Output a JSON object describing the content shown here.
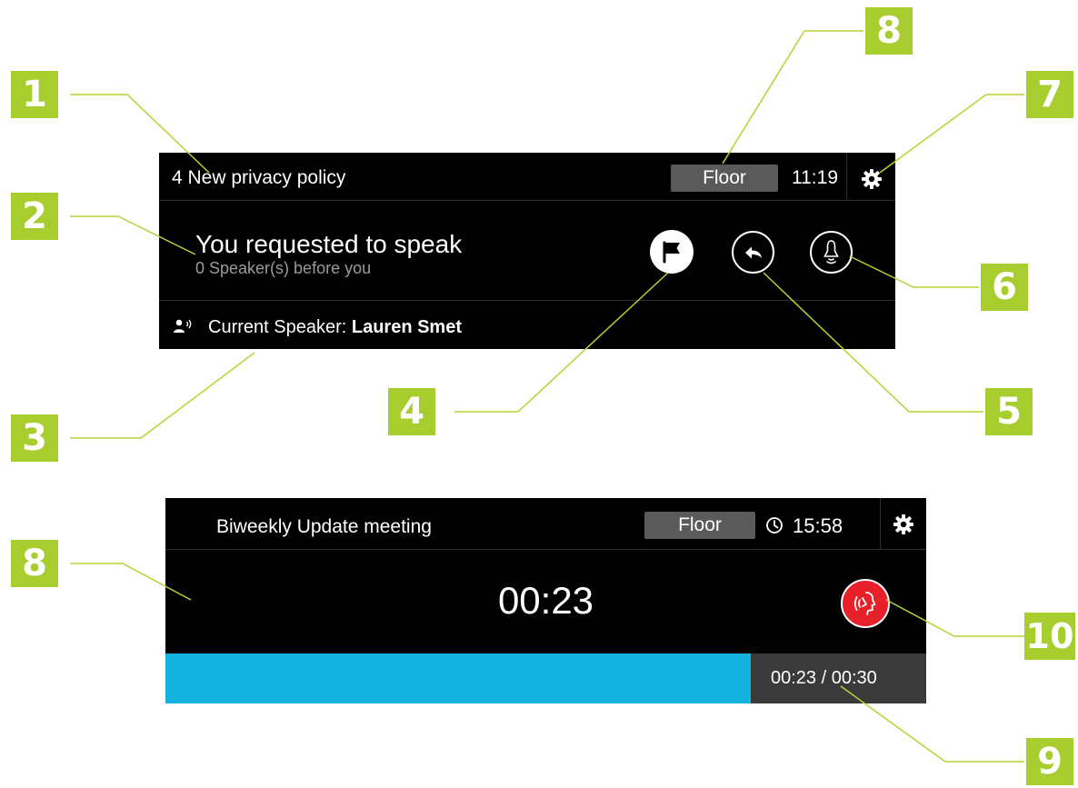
{
  "panel1": {
    "header": {
      "agenda_title": "4 New privacy policy",
      "floor_label": "Floor",
      "time": "11:19"
    },
    "request": {
      "title": "You requested to speak",
      "subtitle": "0 Speaker(s) before you"
    },
    "current_speaker": {
      "label": "Current Speaker:",
      "name": "Lauren Smet"
    }
  },
  "panel2": {
    "header": {
      "meeting_title": "Biweekly Update meeting",
      "floor_label": "Floor",
      "time": "15:58"
    },
    "timer": "00:23",
    "progress": {
      "elapsed": "00:23",
      "total": "00:30",
      "fraction": 0.77
    }
  },
  "callouts": [
    "1",
    "2",
    "3",
    "4",
    "5",
    "6",
    "7",
    "8",
    "8",
    "9",
    "10"
  ],
  "colors": {
    "accent": "#a8cd2e",
    "progress": "#13b2df",
    "mic_active": "#e8202a",
    "panel_bg": "#000000"
  },
  "icons": [
    "settings-icon",
    "flag-icon",
    "reply-icon",
    "priority-bell-icon",
    "speaker-icon",
    "clock-icon",
    "speaking-mic-icon"
  ]
}
